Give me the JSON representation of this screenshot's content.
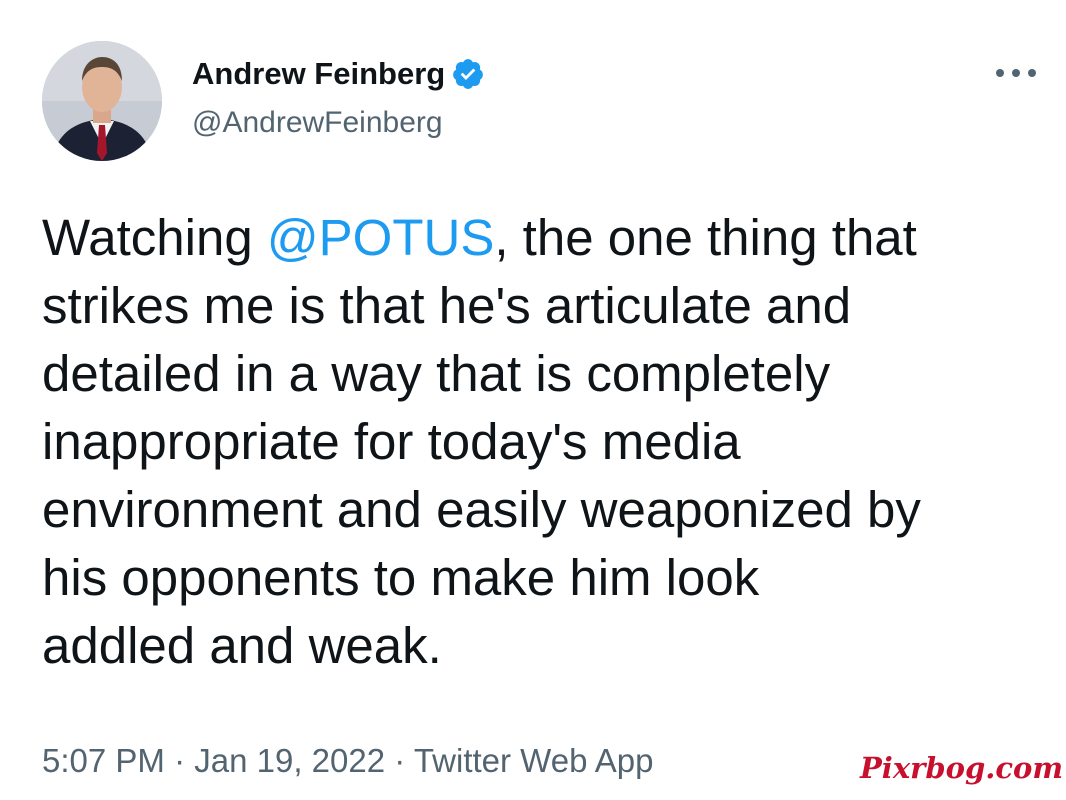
{
  "author": {
    "display_name": "Andrew Feinberg",
    "handle": "@AndrewFeinberg",
    "verified": true
  },
  "more_icon": "more-horizontal-icon",
  "tweet": {
    "lines": [
      {
        "mention": "@POTUS",
        "text": ", the one thing that",
        "prefix": "Watching "
      },
      {
        "text": "strikes me is that he's articulate and"
      },
      {
        "text": "detailed in a way that is completely"
      },
      {
        "text": "inappropriate for today's media"
      },
      {
        "text": "environment and easily weaponized by"
      },
      {
        "text": "his opponents to make him look"
      },
      {
        "text": "addled and weak."
      }
    ]
  },
  "meta": {
    "time": "5:07 PM",
    "sep1": " · ",
    "date": "Jan 19, 2022",
    "sep2": " · ",
    "source": "Twitter Web App"
  },
  "watermark": "Pixrbog.com",
  "colors": {
    "link": "#1d9bf0",
    "secondary_text": "#536471",
    "verified_badge": "#1d9bf0",
    "watermark": "#c8102e"
  }
}
